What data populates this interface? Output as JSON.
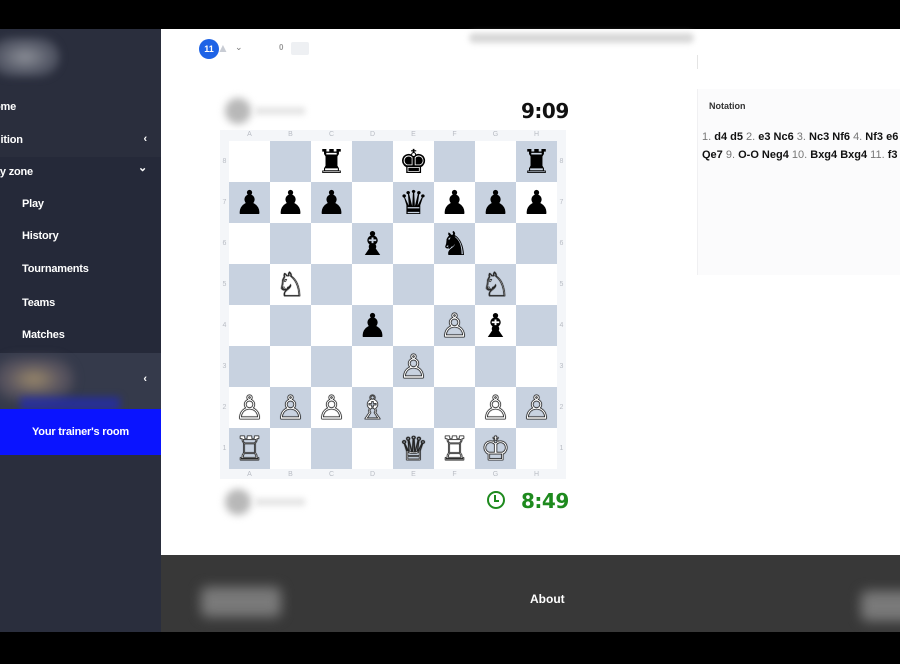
{
  "sidebar": {
    "items": [
      {
        "label": "ome",
        "chevron": ""
      },
      {
        "label": "uition",
        "chevron": "‹"
      },
      {
        "label": "ay zone",
        "chevron": "⌄"
      }
    ],
    "subitems": [
      {
        "label": "Play"
      },
      {
        "label": "History"
      },
      {
        "label": "Tournaments"
      },
      {
        "label": "Teams"
      },
      {
        "label": "Matches"
      }
    ],
    "profile_chevron": "‹",
    "trainer_room": "Your trainer's room"
  },
  "header": {
    "notification_count": "11",
    "message_count": "0",
    "user_menu_chevron": "⌄"
  },
  "game": {
    "top_player": {
      "timer": "9:09"
    },
    "bottom_player": {
      "timer": "8:49"
    },
    "files": [
      "A",
      "B",
      "C",
      "D",
      "E",
      "F",
      "G",
      "H"
    ],
    "ranks": [
      "8",
      "7",
      "6",
      "5",
      "4",
      "3",
      "2",
      "1"
    ],
    "board": [
      [
        "",
        "",
        "r",
        "",
        "k",
        "",
        "",
        "r"
      ],
      [
        "p",
        "p",
        "p",
        "",
        "q",
        "p",
        "p",
        "p"
      ],
      [
        "",
        "",
        "",
        "b",
        "",
        "n",
        "",
        ""
      ],
      [
        "",
        "N",
        "",
        "",
        "",
        "",
        "N",
        ""
      ],
      [
        "",
        "",
        "",
        "p",
        "",
        "P",
        "b",
        ""
      ],
      [
        "",
        "",
        "",
        "",
        "P",
        "",
        "",
        ""
      ],
      [
        "P",
        "P",
        "P",
        "B",
        "",
        "",
        "P",
        "P"
      ],
      [
        "R",
        "",
        "",
        "",
        "Q",
        "R",
        "K",
        ""
      ]
    ],
    "piece_glyphs": {
      "K": "♔",
      "Q": "♕",
      "R": "♖",
      "B": "♗",
      "N": "♘",
      "P": "♙",
      "k": "♚",
      "q": "♛",
      "r": "♜",
      "b": "♝",
      "n": "♞",
      "p": "♟"
    }
  },
  "notation": {
    "title": "Notation",
    "lines": [
      [
        {
          "n": "1.",
          "m": "d4 d5"
        },
        {
          "n": "2.",
          "m": "e3 Nc6"
        },
        {
          "n": "3.",
          "m": "Nc3 Nf6"
        },
        {
          "n": "4.",
          "m": "Nf3 e6"
        }
      ],
      [
        {
          "n": "",
          "m": "Qe7"
        },
        {
          "n": "9.",
          "m": "O-O Neg4"
        },
        {
          "n": "10.",
          "m": "Bxg4 Bxg4"
        },
        {
          "n": "11.",
          "m": "f3"
        }
      ]
    ]
  },
  "footer": {
    "about": "About"
  }
}
